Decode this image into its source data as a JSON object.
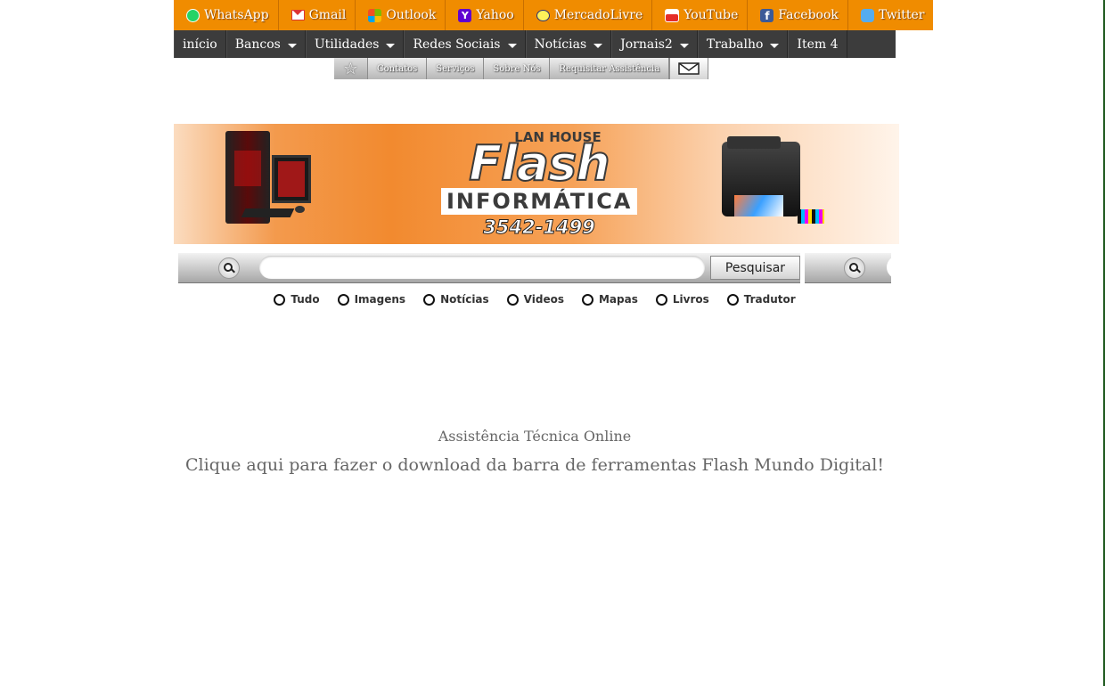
{
  "topbar": {
    "links": [
      {
        "label": "WhatsApp",
        "icon": "whatsapp-icon"
      },
      {
        "label": "Gmail",
        "icon": "gmail-icon"
      },
      {
        "label": "Outlook",
        "icon": "outlook-icon"
      },
      {
        "label": "Yahoo",
        "icon": "yahoo-icon"
      },
      {
        "label": "MercadoLivre",
        "icon": "mercadolivre-icon"
      },
      {
        "label": "YouTube",
        "icon": "youtube-icon"
      },
      {
        "label": "Facebook",
        "icon": "facebook-icon"
      },
      {
        "label": "Twitter",
        "icon": "twitter-icon"
      }
    ],
    "background": "#f08c00"
  },
  "nav": {
    "items": [
      {
        "label": "início",
        "has_dropdown": false
      },
      {
        "label": "Bancos",
        "has_dropdown": true
      },
      {
        "label": "Utilidades",
        "has_dropdown": true
      },
      {
        "label": "Redes Sociais",
        "has_dropdown": true
      },
      {
        "label": "Notícias",
        "has_dropdown": true
      },
      {
        "label": "Jornais2",
        "has_dropdown": true
      },
      {
        "label": "Trabalho",
        "has_dropdown": true
      },
      {
        "label": "Item 4",
        "has_dropdown": false
      }
    ],
    "background": "#3c3c3c"
  },
  "subnav": {
    "items": [
      {
        "label": "Contatos"
      },
      {
        "label": "Serviços"
      },
      {
        "label": "Sobre Nós"
      },
      {
        "label": "Requisitar Assistência"
      }
    ]
  },
  "banner": {
    "top_text": "LAN HOUSE",
    "brand": "Flash",
    "subtitle": "INFORMÁTICA",
    "phone": "3542-1499"
  },
  "search": {
    "placeholder": "",
    "value": "",
    "button_label": "Pesquisar",
    "options": [
      {
        "label": "Tudo"
      },
      {
        "label": "Imagens"
      },
      {
        "label": "Notícias"
      },
      {
        "label": "Videos"
      },
      {
        "label": "Mapas"
      },
      {
        "label": "Livros"
      },
      {
        "label": "Tradutor"
      }
    ]
  },
  "content": {
    "assist_text": "Assistência Técnica Online",
    "download_text": "Clique aqui para fazer o download da barra de ferramentas Flash Mundo Digital!"
  }
}
